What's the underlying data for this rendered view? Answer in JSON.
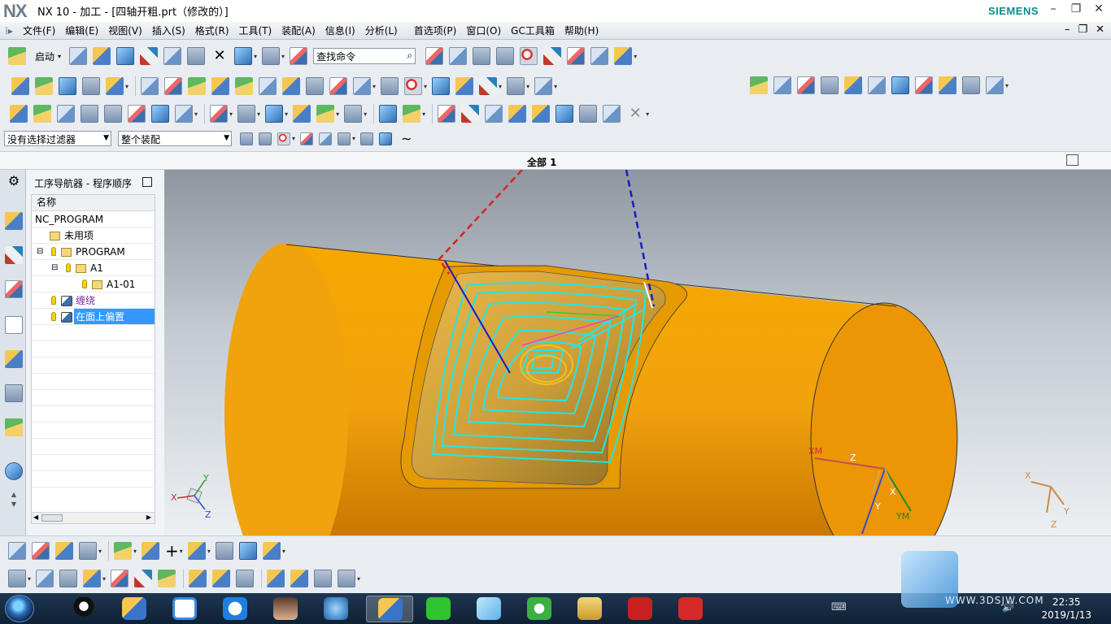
{
  "app": {
    "logo": "NX",
    "window_title": "NX 10 - 加工 - [四轴开粗.prt（修改的）]",
    "brand": "SIEMENS"
  },
  "menu": {
    "items": [
      "文件(F)",
      "编辑(E)",
      "视图(V)",
      "插入(S)",
      "格式(R)",
      "工具(T)",
      "装配(A)",
      "信息(I)",
      "分析(L)",
      "首选项(P)",
      "窗口(O)",
      "GC工具箱",
      "帮助(H)"
    ]
  },
  "toolbar": {
    "start_label": "启动",
    "search_placeholder": "查找命令"
  },
  "filters": {
    "selection_filter": "没有选择过滤器",
    "assembly_scope": "整个装配"
  },
  "view": {
    "title": "全部 1"
  },
  "navigator": {
    "title": "工序导航器 - 程序顺序",
    "column_name": "名称",
    "rows": [
      {
        "label": "NC_PROGRAM",
        "indent": 0
      },
      {
        "label": "未用项",
        "indent": 1
      },
      {
        "label": "PROGRAM",
        "indent": 1
      },
      {
        "label": "A1",
        "indent": 2
      },
      {
        "label": "A1-01",
        "indent": 3
      },
      {
        "label": "缠绕",
        "indent": 1
      },
      {
        "label": "在面上偏置",
        "indent": 1,
        "selected": true
      }
    ]
  },
  "viewport": {
    "wcs_labels": [
      "XM",
      "Z",
      "X",
      "YM",
      "Y"
    ],
    "triad_left": [
      "Y",
      "X",
      "Z"
    ],
    "triad_right": [
      "X",
      "Y",
      "Z"
    ]
  },
  "taskbar": {
    "time": "22:35",
    "date": "2019/1/13"
  },
  "watermark": "WWW.3DSJW.COM",
  "colors": {
    "part_orange": "#f2a20d",
    "toolpath_cyan": "#22e6e6",
    "selection_blue": "#3399ff"
  }
}
